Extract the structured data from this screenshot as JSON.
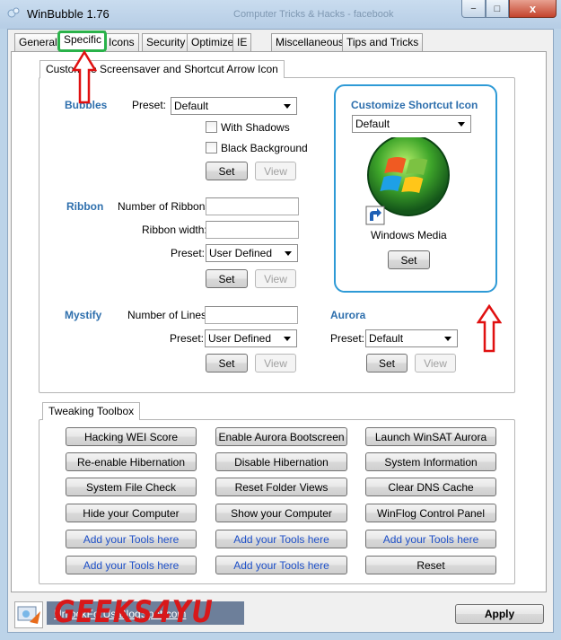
{
  "window": {
    "title": "WinBubble 1.76",
    "background_title": "Computer Tricks & Hacks - facebook",
    "close_label": "x",
    "min_label": "−",
    "max_label": "□"
  },
  "tabs": [
    "General",
    "Specific",
    "Icons",
    "Security",
    "Optimize",
    "IE",
    "Miscellaneous",
    "Tips and Tricks"
  ],
  "active_tab": "Specific",
  "screensaver_group": {
    "title": "Customize Screensaver and Shortcut Arrow Icon",
    "bubbles": {
      "heading": "Bubbles",
      "preset_label": "Preset:",
      "preset_value": "Default",
      "with_shadows": "With Shadows",
      "black_background": "Black Background",
      "set": "Set",
      "view": "View"
    },
    "ribbon": {
      "heading": "Ribbon",
      "num_label": "Number of Ribbons:",
      "width_label": "Ribbon width:",
      "preset_label": "Preset:",
      "preset_value": "User Defined",
      "set": "Set",
      "view": "View"
    },
    "mystify": {
      "heading": "Mystify",
      "lines_label": "Number of Lines:",
      "preset_label": "Preset:",
      "preset_value": "User Defined",
      "set": "Set",
      "view": "View"
    },
    "aurora": {
      "heading": "Aurora",
      "preset_label": "Preset:",
      "preset_value": "Default",
      "set": "Set",
      "view": "View"
    },
    "shortcut": {
      "heading": "Customize Shortcut Icon",
      "preset_value": "Default",
      "icon_caption": "Windows Media",
      "set": "Set"
    }
  },
  "toolbox": {
    "title": "Tweaking Toolbox",
    "buttons": [
      [
        "Hacking WEI Score",
        "Enable Aurora Bootscreen",
        "Launch WinSAT Aurora"
      ],
      [
        "Re-enable Hibernation",
        "Disable Hibernation",
        "System Information"
      ],
      [
        "System File Check",
        "Reset Folder Views",
        "Clear DNS Cache"
      ],
      [
        "Hide your Computer",
        "Show your Computer",
        "WinFlog Control Panel"
      ],
      [
        "Add your Tools here",
        "Add your Tools here",
        "Add your Tools here"
      ],
      [
        "Add your Tools here",
        "Add your Tools here",
        "Reset"
      ]
    ]
  },
  "footer": {
    "link": "UnlockForUs.BlogSpot.com",
    "watermark": "GEEKS4YU",
    "apply": "Apply"
  }
}
